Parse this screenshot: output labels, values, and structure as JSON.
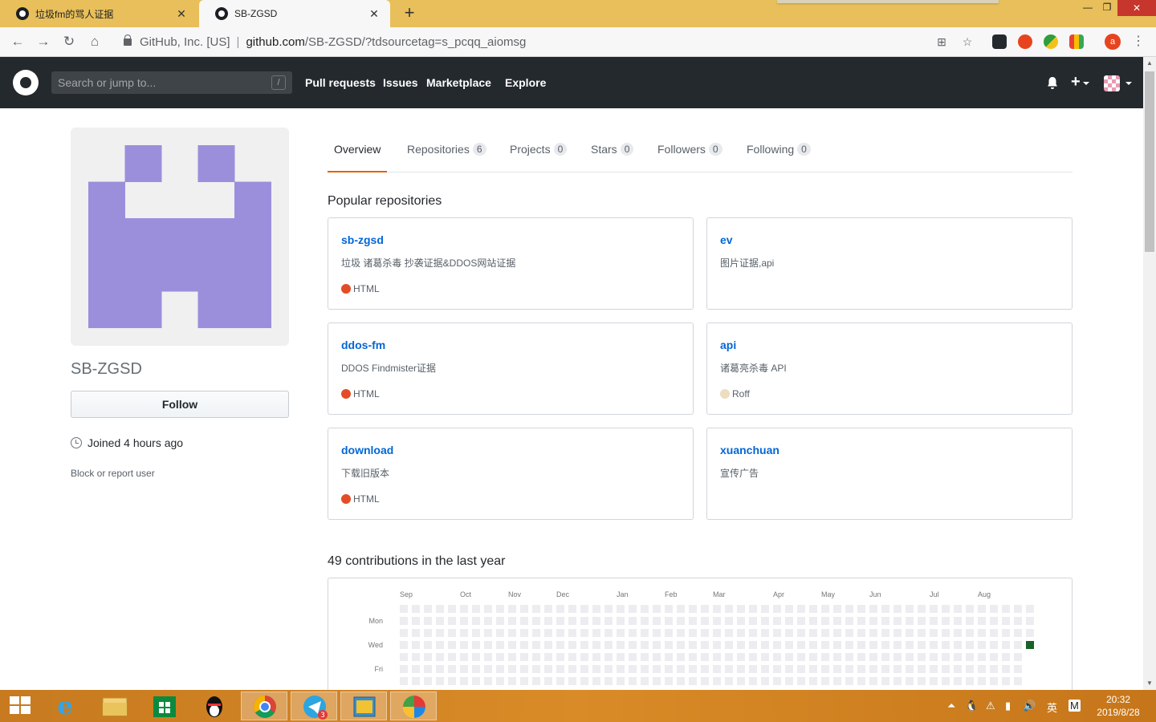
{
  "browser": {
    "tabs": [
      {
        "label": "垃圾fm的骂人证据",
        "close": "✕"
      },
      {
        "label": "SB-ZGSD",
        "close": "✕"
      }
    ],
    "new_tab": "+",
    "url": {
      "org": "GitHub, Inc. [US]",
      "host": "github.com",
      "path": "/SB-ZGSD/?tdsourcetag=s_pcqq_aiomsg"
    },
    "profile_initial": "a",
    "win_controls": {
      "minimize": "—",
      "restore": "❐",
      "close": "✕"
    }
  },
  "github": {
    "search_placeholder": "Search or jump to...",
    "search_hint": "/",
    "nav": [
      "Pull requests",
      "Issues",
      "Marketplace",
      "Explore"
    ],
    "plus": "+"
  },
  "profile": {
    "username": "SB-ZGSD",
    "follow_label": "Follow",
    "joined": "Joined 4 hours ago",
    "block_label": "Block or report user",
    "avatar_color": "#9b8fdc"
  },
  "tabs": [
    {
      "label": "Overview",
      "count": null
    },
    {
      "label": "Repositories",
      "count": "6"
    },
    {
      "label": "Projects",
      "count": "0"
    },
    {
      "label": "Stars",
      "count": "0"
    },
    {
      "label": "Followers",
      "count": "0"
    },
    {
      "label": "Following",
      "count": "0"
    }
  ],
  "popular_title": "Popular repositories",
  "repos": [
    {
      "name": "sb-zgsd",
      "desc": "垃圾 诸葛杀毒 抄袭证据&DDOS网站证据",
      "lang": "HTML",
      "lang_color": "#e34c26"
    },
    {
      "name": "ev",
      "desc": "图片证据,api",
      "lang": "",
      "lang_color": ""
    },
    {
      "name": "ddos-fm",
      "desc": "DDOS Findmister证据",
      "lang": "HTML",
      "lang_color": "#e34c26"
    },
    {
      "name": "api",
      "desc": "诸葛亮杀毒 API",
      "lang": "Roff",
      "lang_color": "#ecdebe"
    },
    {
      "name": "download",
      "desc": "下载旧版本",
      "lang": "HTML",
      "lang_color": "#e34c26"
    },
    {
      "name": "xuanchuan",
      "desc": "宣传广告",
      "lang": "",
      "lang_color": ""
    }
  ],
  "contributions": {
    "title": "49 contributions in the last year",
    "months": [
      "Sep",
      "Oct",
      "Nov",
      "Dec",
      "Jan",
      "Feb",
      "Mar",
      "Apr",
      "May",
      "Jun",
      "Jul",
      "Aug"
    ],
    "days": [
      "Mon",
      "Wed",
      "Fri"
    ],
    "empty_color": "#ebedf0",
    "active_color": "#196127"
  },
  "taskbar": {
    "clock_time": "20:32",
    "clock_date": "2019/8/28",
    "ime": "英",
    "ime2": "M",
    "telegram_badge": "3"
  }
}
